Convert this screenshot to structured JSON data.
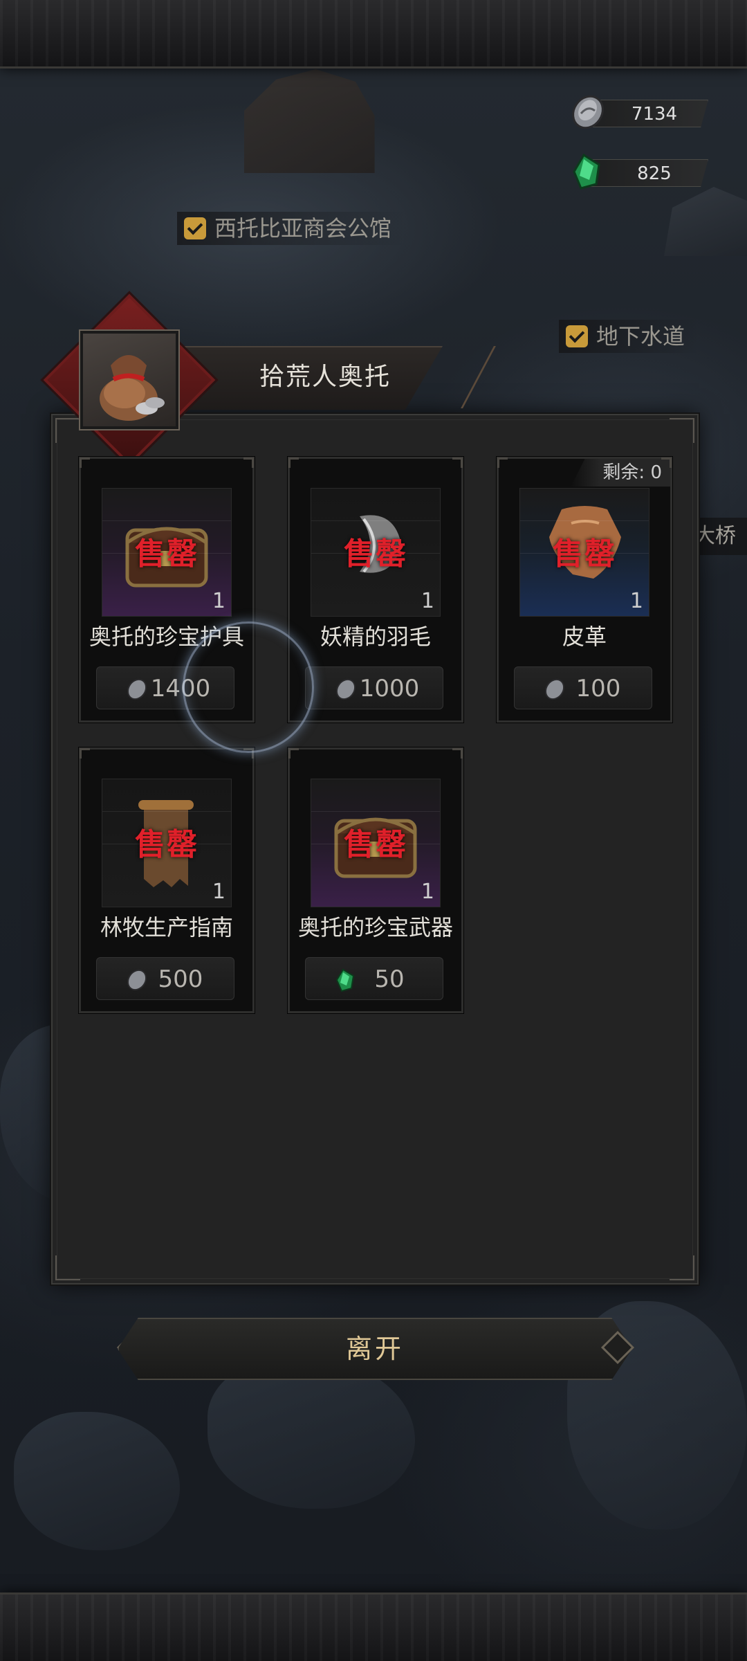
{
  "currency": {
    "silver": {
      "icon": "silver-coin-icon",
      "value": "7134"
    },
    "emerald": {
      "icon": "green-gem-icon",
      "value": "825"
    }
  },
  "map": {
    "labels": [
      {
        "text": "西托比亚商会公馆"
      },
      {
        "text": "地下水道"
      }
    ],
    "side_label": "大桥"
  },
  "shop": {
    "npc_name": "拾荒人奥托",
    "npc_icon": "scavenger-otto-avatar",
    "remaining_label": "剩余: 0",
    "sold_out_label": "售罄",
    "items": [
      {
        "name": "奥托的珍宝护具",
        "qty": "1",
        "price": "1400",
        "currency": "silver",
        "rarity": "purple"
      },
      {
        "name": "妖精的羽毛",
        "qty": "1",
        "price": "1000",
        "currency": "silver",
        "rarity": "plain"
      },
      {
        "name": "皮革",
        "qty": "1",
        "price": "100",
        "currency": "silver",
        "rarity": "blue"
      },
      {
        "name": "林牧生产指南",
        "qty": "1",
        "price": "500",
        "currency": "silver",
        "rarity": "plain"
      },
      {
        "name": "奥托的珍宝武器",
        "qty": "1",
        "price": "50",
        "currency": "emerald",
        "rarity": "purple"
      }
    ]
  },
  "leave_button": {
    "label": "离开"
  },
  "colors": {
    "sold_out": "#e0202a",
    "accent_gold": "#e0c896",
    "panel": "#232323"
  }
}
